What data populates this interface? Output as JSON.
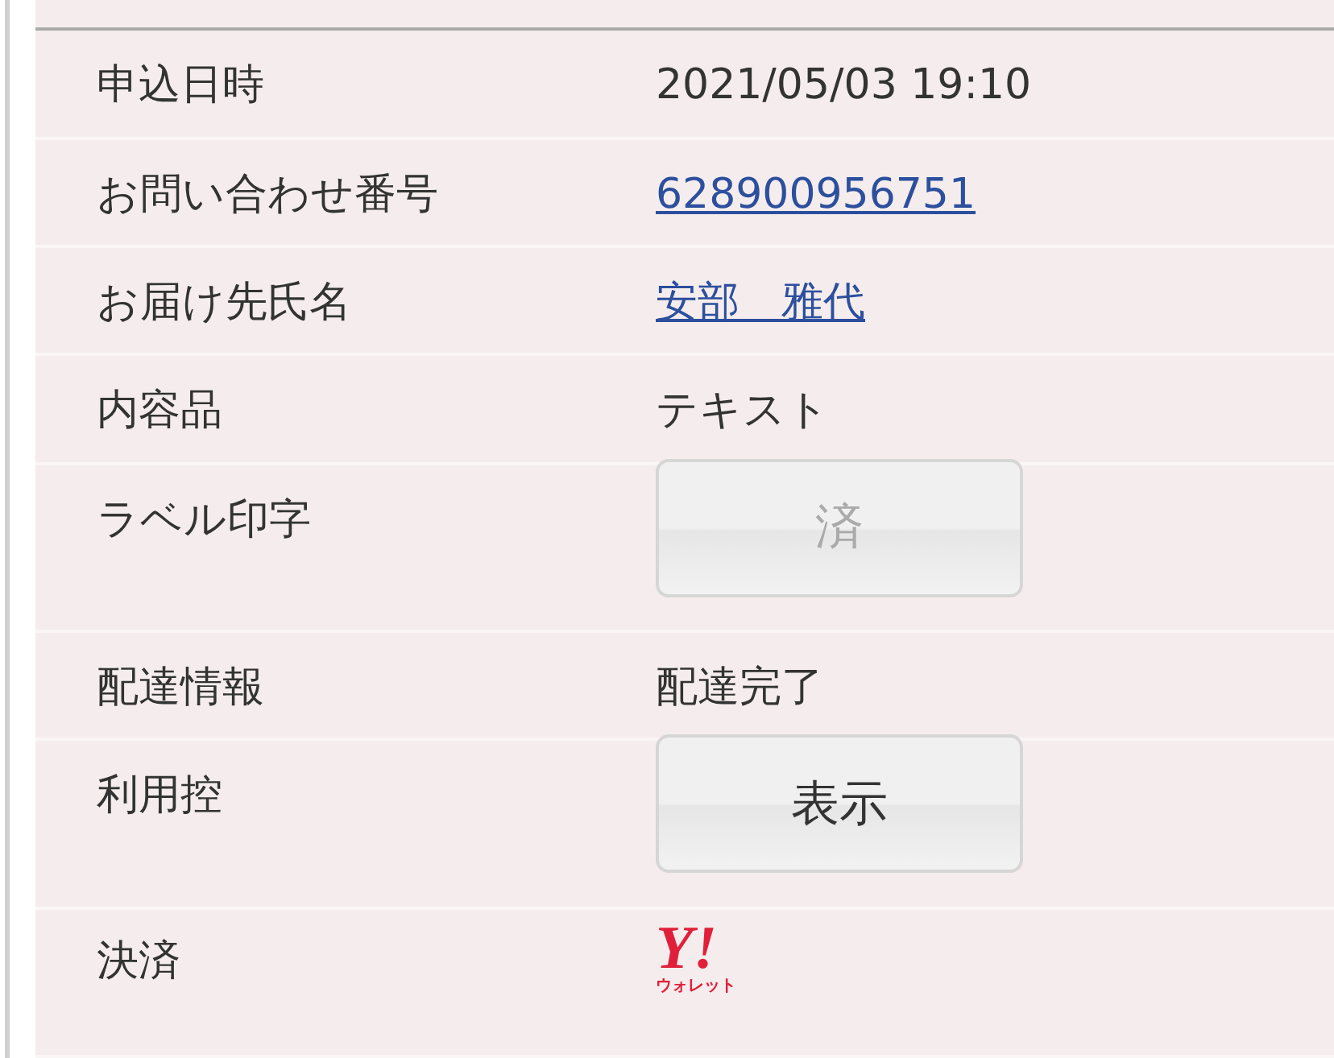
{
  "rows": [
    {
      "label": "申込日時",
      "kind": "text",
      "value": "2021/05/03 19:10"
    },
    {
      "label": "お問い合わせ番号",
      "kind": "link",
      "value": "628900956751"
    },
    {
      "label": "お届け先氏名",
      "kind": "link",
      "value": "安部　雅代"
    },
    {
      "label": "内容品",
      "kind": "text",
      "value": "テキスト"
    },
    {
      "label": "ラベル印字",
      "kind": "button",
      "value": "済",
      "disabled": true
    },
    {
      "label": "配達情報",
      "kind": "text",
      "value": "配達完了"
    },
    {
      "label": "利用控",
      "kind": "button",
      "value": "表示",
      "disabled": false
    },
    {
      "label": "決済",
      "kind": "logo",
      "mark": "Y!",
      "caption": "ウォレット"
    }
  ]
}
